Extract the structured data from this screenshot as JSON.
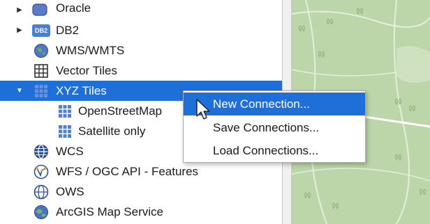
{
  "tree": {
    "items": [
      {
        "label": "Oracle",
        "icon": "oracle-db-icon",
        "expander": "collapsed"
      },
      {
        "label": "DB2",
        "icon": "db2-icon",
        "icon_text": "DB2",
        "expander": "collapsed"
      },
      {
        "label": "WMS/WMTS",
        "icon": "wms-globe-icon",
        "expander": "none"
      },
      {
        "label": "Vector Tiles",
        "icon": "vector-tiles-grid-icon",
        "expander": "none"
      },
      {
        "label": "XYZ Tiles",
        "icon": "xyz-tiles-grid-icon",
        "expander": "expanded",
        "selected": true
      },
      {
        "label": "OpenStreetMap",
        "icon": "tile-grid-icon",
        "expander": "none"
      },
      {
        "label": "Satellite only",
        "icon": "tile-grid-icon",
        "expander": "none"
      },
      {
        "label": "WCS",
        "icon": "wcs-globe-icon",
        "expander": "none"
      },
      {
        "label": "WFS / OGC API - Features",
        "icon": "wfs-globe-icon",
        "expander": "none"
      },
      {
        "label": "OWS",
        "icon": "ows-globe-icon",
        "expander": "none"
      },
      {
        "label": "ArcGIS Map Service",
        "icon": "arcgis-globe-icon",
        "expander": "none"
      }
    ]
  },
  "context_menu": {
    "items": [
      {
        "label": "New Connection...",
        "hovered": true
      },
      {
        "label": "Save Connections..."
      },
      {
        "label": "Load Connections..."
      }
    ]
  },
  "colors": {
    "selection": "#1f6fd8",
    "map_background": "#bcd6a9",
    "map_lines": "#e6eede",
    "map_trees": "#8fb07b"
  }
}
